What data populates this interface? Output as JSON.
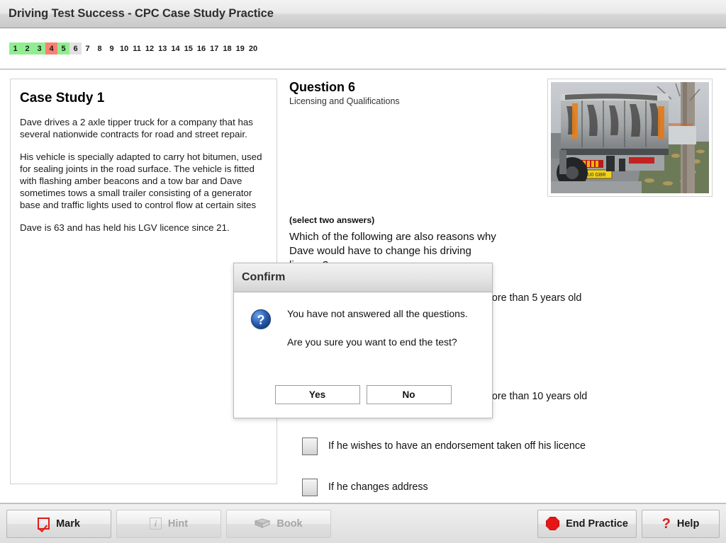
{
  "window": {
    "title": "Driving Test Success - CPC Case Study Practice"
  },
  "question_strip": {
    "items": [
      {
        "label": "1",
        "state": "correct"
      },
      {
        "label": "2",
        "state": "correct"
      },
      {
        "label": "3",
        "state": "correct"
      },
      {
        "label": "4",
        "state": "wrong"
      },
      {
        "label": "5",
        "state": "correct"
      },
      {
        "label": "6",
        "state": "current"
      },
      {
        "label": "7",
        "state": "none"
      },
      {
        "label": "8",
        "state": "none"
      },
      {
        "label": "9",
        "state": "none"
      },
      {
        "label": "10",
        "state": "none"
      },
      {
        "label": "11",
        "state": "none"
      },
      {
        "label": "12",
        "state": "none"
      },
      {
        "label": "13",
        "state": "none"
      },
      {
        "label": "14",
        "state": "none"
      },
      {
        "label": "15",
        "state": "none"
      },
      {
        "label": "16",
        "state": "none"
      },
      {
        "label": "17",
        "state": "none"
      },
      {
        "label": "18",
        "state": "none"
      },
      {
        "label": "19",
        "state": "none"
      },
      {
        "label": "20",
        "state": "none"
      }
    ]
  },
  "case_study": {
    "title": "Case Study 1",
    "paragraphs": [
      "Dave drives a 2 axle tipper truck for a company that has several nationwide contracts for road and street repair.",
      "His vehicle is specially adapted to carry hot bitumen, used for sealing joints in the road surface. The vehicle is fitted with flashing amber beacons and a tow bar and Dave sometimes tows a small trailer consisting of a generator base and traffic lights used to control flow at certain sites",
      "Dave is 63 and has held his LGV licence since 21."
    ]
  },
  "question": {
    "title": "Question 6",
    "topic": "Licensing and Qualifications",
    "select_note": "(select two answers)",
    "text": "Which of the following are also reasons why Dave would have to change his driving licence?",
    "options": [
      {
        "label": "more than 5 years old",
        "checked": false,
        "truncated": true
      },
      {
        "label": "more than 10 years old",
        "checked": false,
        "truncated": true
      },
      {
        "label": "If he wishes to have an endorsement taken off his licence",
        "checked": false,
        "truncated": false
      },
      {
        "label": "If he changes address",
        "checked": false,
        "truncated": false
      }
    ]
  },
  "photo": {
    "alt": "Rear view of a grey two axle tipper truck parked at a roadside with yellow number plate"
  },
  "dialog": {
    "title": "Confirm",
    "icon": "question-icon",
    "messages": [
      "You have not answered all the questions.",
      "Are you sure you want to end the test?"
    ],
    "buttons": [
      {
        "label": "Yes"
      },
      {
        "label": "No"
      }
    ]
  },
  "toolbar": {
    "left": [
      {
        "label": "Mark",
        "icon": "checkbox-tick-icon",
        "disabled": false
      },
      {
        "label": "Hint",
        "icon": "info-icon",
        "disabled": true
      },
      {
        "label": "Book",
        "icon": "book-icon",
        "disabled": true
      }
    ],
    "right": [
      {
        "label": "End Practice",
        "icon": "stop-sign-icon",
        "disabled": false
      },
      {
        "label": "Help",
        "icon": "question-mark-icon",
        "disabled": false
      }
    ]
  },
  "colors": {
    "correct": "#90ee90",
    "wrong": "#fa8072",
    "current": "#e2e2e2",
    "accent_red": "#e01b1b",
    "dialog_icon_blue": "#2a5db0"
  }
}
